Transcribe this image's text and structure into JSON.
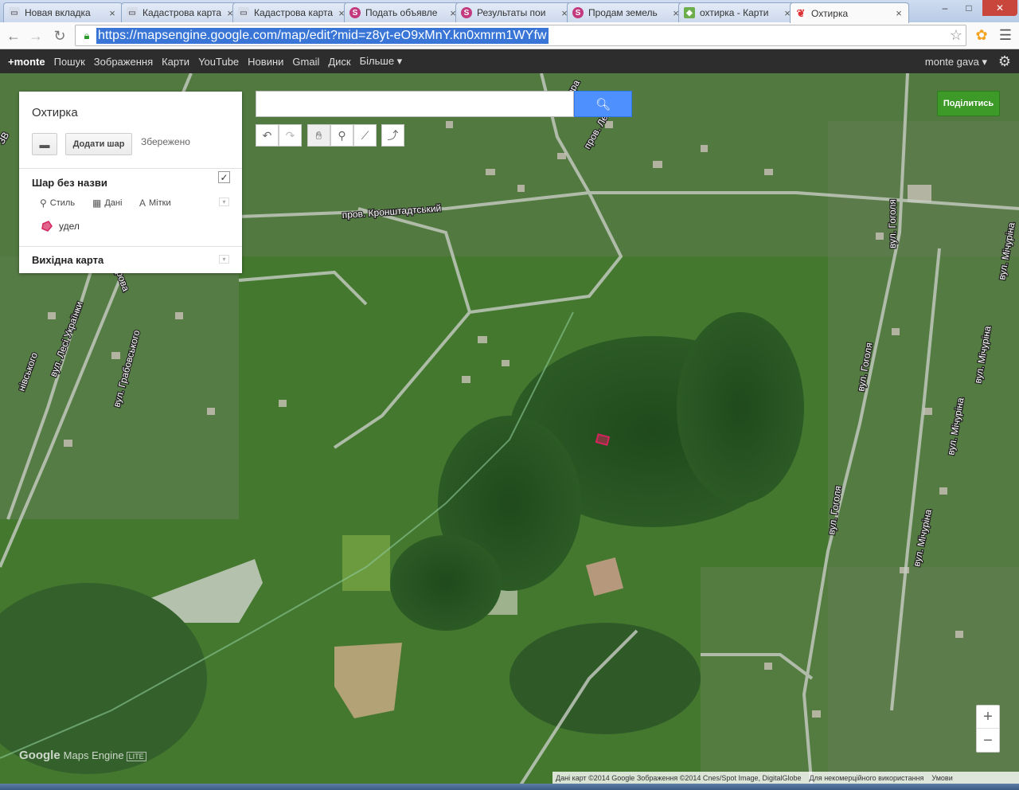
{
  "browser": {
    "tabs": [
      {
        "title": "Новая вкладка",
        "icon": "page-icon"
      },
      {
        "title": "Кадастрова карта",
        "icon": "page-icon"
      },
      {
        "title": "Кадастрова карта",
        "icon": "page-icon"
      },
      {
        "title": "Подать объявле",
        "icon": "site-s-icon"
      },
      {
        "title": "Результаты пои",
        "icon": "site-s-icon"
      },
      {
        "title": "Продам земель",
        "icon": "site-s-icon"
      },
      {
        "title": "охтирка - Карти",
        "icon": "maps-icon"
      },
      {
        "title": "Охтирка",
        "icon": "mapsengine-icon"
      }
    ],
    "tab_close": "×",
    "url": "https://mapsengine.google.com/map/edit?mid=z8yt-eO9xMnY.kn0xmrm1WYfw",
    "window_controls": {
      "minimize": "–",
      "maximize": "□",
      "close": "✕"
    }
  },
  "google_bar": {
    "links": [
      "+monte",
      "Пошук",
      "Зображення",
      "Карти",
      "YouTube",
      "Новини",
      "Gmail",
      "Диск",
      "Більше ▾"
    ],
    "user": "monte gava ▾"
  },
  "panel": {
    "map_title": "Охтирка",
    "add_layer": "Додати шар",
    "saved_status": "Збережено",
    "layer": {
      "name": "Шар без назви",
      "checked": "✓",
      "actions": [
        "Стиль",
        "Дані",
        "Мітки"
      ],
      "features": [
        {
          "label": "удел",
          "color": "#d4245c"
        }
      ]
    },
    "basemap_label": "Вихідна карта"
  },
  "search": {
    "placeholder": ""
  },
  "share_button": "Поділитись",
  "zoom": {
    "in": "+",
    "out": "−"
  },
  "logo": {
    "google": "Google",
    "product": "Maps Engine",
    "badge": "LITE"
  },
  "attribution": {
    "data": "Дані карт ©2014 Google Зображення ©2014 Cnes/Spot Image, DigitalGlobe",
    "noncommercial": "Для некомерційного використання",
    "terms": "Умови"
  },
  "street_labels": [
    "пров. Кронштадтський",
    "вул. Гоголя",
    "вул. Гоголя",
    "вул. Гоголя",
    "вул. Мічуріна",
    "вул. Мічуріна",
    "вул. Мічуріна",
    "вул. Мічуріна",
    "вул. Грабовського",
    "вул. Лесі Українки",
    "пров. Ле",
    "опера",
    "рова",
    "нівського",
    "ЗВ"
  ],
  "colors": {
    "accent": "#4d90fe",
    "share": "#3d9a29",
    "feature": "#d4245c"
  }
}
